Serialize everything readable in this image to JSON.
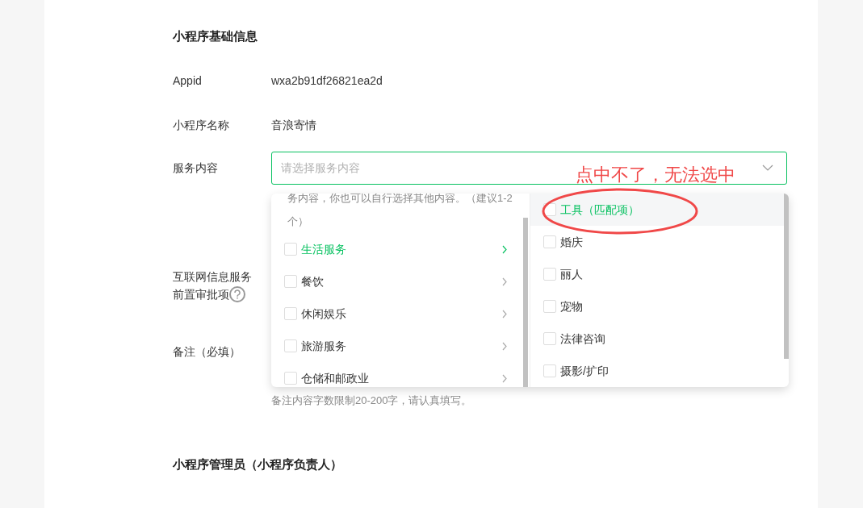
{
  "section_title": "小程序基础信息",
  "fields": [
    {
      "label": "Appid",
      "value": "wxa2b91df26821ea2d"
    },
    {
      "label": "小程序名称",
      "value": "音浪寄情"
    }
  ],
  "service_select": {
    "label": "服务内容",
    "placeholder": "请选择服务内容",
    "expanded": true
  },
  "dropdown": {
    "hint": "务内容，你也可以自行选择其他内容。（建议1-2个）",
    "categories": [
      {
        "label": "生活服务",
        "checked": false,
        "selected": true
      },
      {
        "label": "餐饮",
        "checked": false,
        "selected": false
      },
      {
        "label": "休闲娱乐",
        "checked": false,
        "selected": false
      },
      {
        "label": "旅游服务",
        "checked": false,
        "selected": false
      },
      {
        "label": "仓储和邮政业",
        "checked": false,
        "selected": false
      }
    ],
    "subcategories": [
      {
        "label": "工具（匹配项）",
        "checked": false,
        "selected": true
      },
      {
        "label": "婚庆",
        "checked": false,
        "selected": false
      },
      {
        "label": "丽人",
        "checked": false,
        "selected": false
      },
      {
        "label": "宠物",
        "checked": false,
        "selected": false
      },
      {
        "label": "法律咨询",
        "checked": false,
        "selected": false
      },
      {
        "label": "摄影/扩印",
        "checked": false,
        "selected": false
      }
    ]
  },
  "approval_label": [
    "互联网信息服务",
    "前置审批项"
  ],
  "remark": {
    "label": "备注（必填）",
    "hint": "备注内容字数限制20-200字，请认真填写。"
  },
  "annotation": "点中不了，无法选中",
  "admin_section_title": "小程序管理员（小程序负责人）"
}
